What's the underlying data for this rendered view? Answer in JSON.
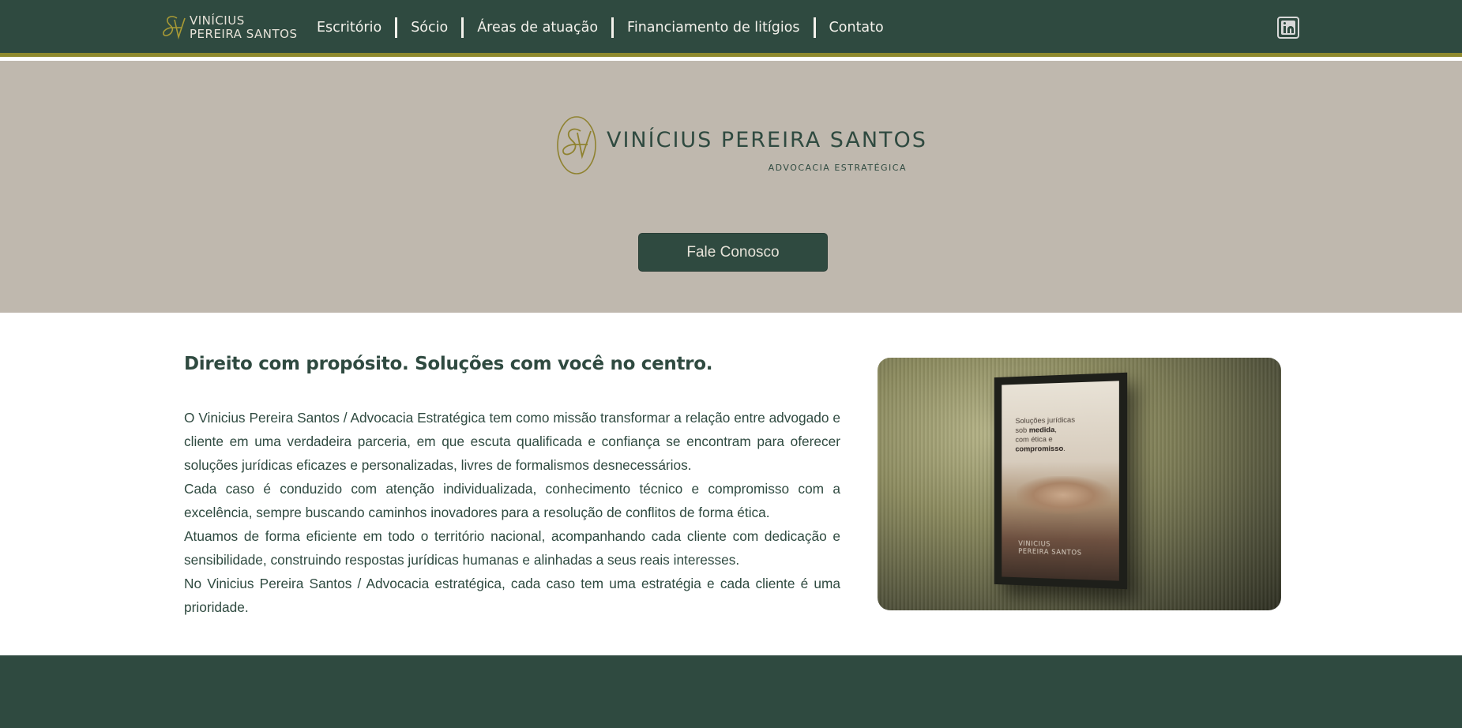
{
  "brand": {
    "name_line1": "VINÍCIUS",
    "name_line2": "PEREIRA SANTOS",
    "monogram": "&V",
    "colors": {
      "primary": "#2f4a40",
      "accent": "#8f8a2e",
      "hero_bg": "#bfb8ae"
    }
  },
  "nav": {
    "items": [
      {
        "label": "Escritório"
      },
      {
        "label": "Sócio"
      },
      {
        "label": "Áreas de atuação"
      },
      {
        "label": "Financiamento de litígios"
      },
      {
        "label": "Contato"
      }
    ],
    "social_icon": "linkedin-icon"
  },
  "hero": {
    "name_bold": "VINÍCIUS",
    "name_light": "PEREIRA SANTOS",
    "subtitle": "ADVOCACIA ESTRATÉGICA",
    "cta_label": "Fale Conosco"
  },
  "about": {
    "title": "Direito com propósito. Soluções com você no centro.",
    "paragraphs": [
      "O Vinicius Pereira Santos / Advocacia Estratégica tem como missão transformar a relação entre advogado e cliente em uma verdadeira parceria, em que escuta qualificada e confiança se encontram para oferecer soluções jurídicas eficazes e personalizadas, livres de formalismos desnecessários.",
      "Cada caso é conduzido com atenção individualizada, conhecimento técnico e compromisso com a excelência, sempre buscando caminhos inovadores para a resolução de conflitos de forma ética.",
      "Atuamos de forma eficiente em todo o território nacional, acompanhando cada cliente com dedicação e sensibilidade, construindo respostas jurídicas humanas e alinhadas a seus reais interesses.",
      "No Vinicius Pereira Santos / Advocacia estratégica, cada caso tem uma estratégia e cada cliente é uma prioridade."
    ],
    "poster": {
      "line1": "Soluções jurídicas",
      "line2_pre": "sob ",
      "line2_bold": "medida",
      "line2_post": ",",
      "line3": "com ética e",
      "line4_bold": "compromisso",
      "line4_post": ".",
      "brand_line1": "VINICIUS",
      "brand_line2": "PEREIRA SANTOS"
    }
  }
}
